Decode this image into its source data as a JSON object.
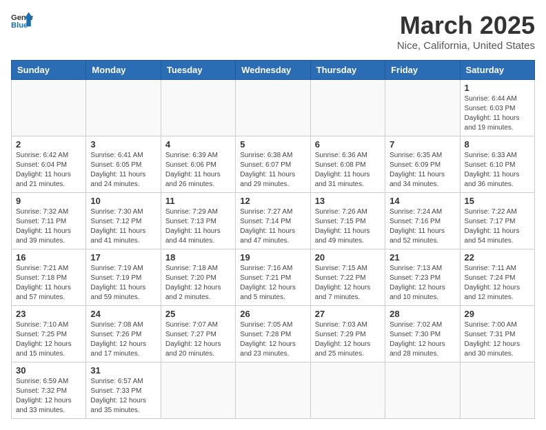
{
  "header": {
    "logo_general": "General",
    "logo_blue": "Blue",
    "title": "March 2025",
    "subtitle": "Nice, California, United States"
  },
  "days_of_week": [
    "Sunday",
    "Monday",
    "Tuesday",
    "Wednesday",
    "Thursday",
    "Friday",
    "Saturday"
  ],
  "weeks": [
    [
      {
        "day": "",
        "info": ""
      },
      {
        "day": "",
        "info": ""
      },
      {
        "day": "",
        "info": ""
      },
      {
        "day": "",
        "info": ""
      },
      {
        "day": "",
        "info": ""
      },
      {
        "day": "",
        "info": ""
      },
      {
        "day": "1",
        "info": "Sunrise: 6:44 AM\nSunset: 6:03 PM\nDaylight: 11 hours\nand 19 minutes."
      }
    ],
    [
      {
        "day": "2",
        "info": "Sunrise: 6:42 AM\nSunset: 6:04 PM\nDaylight: 11 hours\nand 21 minutes."
      },
      {
        "day": "3",
        "info": "Sunrise: 6:41 AM\nSunset: 6:05 PM\nDaylight: 11 hours\nand 24 minutes."
      },
      {
        "day": "4",
        "info": "Sunrise: 6:39 AM\nSunset: 6:06 PM\nDaylight: 11 hours\nand 26 minutes."
      },
      {
        "day": "5",
        "info": "Sunrise: 6:38 AM\nSunset: 6:07 PM\nDaylight: 11 hours\nand 29 minutes."
      },
      {
        "day": "6",
        "info": "Sunrise: 6:36 AM\nSunset: 6:08 PM\nDaylight: 11 hours\nand 31 minutes."
      },
      {
        "day": "7",
        "info": "Sunrise: 6:35 AM\nSunset: 6:09 PM\nDaylight: 11 hours\nand 34 minutes."
      },
      {
        "day": "8",
        "info": "Sunrise: 6:33 AM\nSunset: 6:10 PM\nDaylight: 11 hours\nand 36 minutes."
      }
    ],
    [
      {
        "day": "9",
        "info": "Sunrise: 7:32 AM\nSunset: 7:11 PM\nDaylight: 11 hours\nand 39 minutes."
      },
      {
        "day": "10",
        "info": "Sunrise: 7:30 AM\nSunset: 7:12 PM\nDaylight: 11 hours\nand 41 minutes."
      },
      {
        "day": "11",
        "info": "Sunrise: 7:29 AM\nSunset: 7:13 PM\nDaylight: 11 hours\nand 44 minutes."
      },
      {
        "day": "12",
        "info": "Sunrise: 7:27 AM\nSunset: 7:14 PM\nDaylight: 11 hours\nand 47 minutes."
      },
      {
        "day": "13",
        "info": "Sunrise: 7:26 AM\nSunset: 7:15 PM\nDaylight: 11 hours\nand 49 minutes."
      },
      {
        "day": "14",
        "info": "Sunrise: 7:24 AM\nSunset: 7:16 PM\nDaylight: 11 hours\nand 52 minutes."
      },
      {
        "day": "15",
        "info": "Sunrise: 7:22 AM\nSunset: 7:17 PM\nDaylight: 11 hours\nand 54 minutes."
      }
    ],
    [
      {
        "day": "16",
        "info": "Sunrise: 7:21 AM\nSunset: 7:18 PM\nDaylight: 11 hours\nand 57 minutes."
      },
      {
        "day": "17",
        "info": "Sunrise: 7:19 AM\nSunset: 7:19 PM\nDaylight: 11 hours\nand 59 minutes."
      },
      {
        "day": "18",
        "info": "Sunrise: 7:18 AM\nSunset: 7:20 PM\nDaylight: 12 hours\nand 2 minutes."
      },
      {
        "day": "19",
        "info": "Sunrise: 7:16 AM\nSunset: 7:21 PM\nDaylight: 12 hours\nand 5 minutes."
      },
      {
        "day": "20",
        "info": "Sunrise: 7:15 AM\nSunset: 7:22 PM\nDaylight: 12 hours\nand 7 minutes."
      },
      {
        "day": "21",
        "info": "Sunrise: 7:13 AM\nSunset: 7:23 PM\nDaylight: 12 hours\nand 10 minutes."
      },
      {
        "day": "22",
        "info": "Sunrise: 7:11 AM\nSunset: 7:24 PM\nDaylight: 12 hours\nand 12 minutes."
      }
    ],
    [
      {
        "day": "23",
        "info": "Sunrise: 7:10 AM\nSunset: 7:25 PM\nDaylight: 12 hours\nand 15 minutes."
      },
      {
        "day": "24",
        "info": "Sunrise: 7:08 AM\nSunset: 7:26 PM\nDaylight: 12 hours\nand 17 minutes."
      },
      {
        "day": "25",
        "info": "Sunrise: 7:07 AM\nSunset: 7:27 PM\nDaylight: 12 hours\nand 20 minutes."
      },
      {
        "day": "26",
        "info": "Sunrise: 7:05 AM\nSunset: 7:28 PM\nDaylight: 12 hours\nand 23 minutes."
      },
      {
        "day": "27",
        "info": "Sunrise: 7:03 AM\nSunset: 7:29 PM\nDaylight: 12 hours\nand 25 minutes."
      },
      {
        "day": "28",
        "info": "Sunrise: 7:02 AM\nSunset: 7:30 PM\nDaylight: 12 hours\nand 28 minutes."
      },
      {
        "day": "29",
        "info": "Sunrise: 7:00 AM\nSunset: 7:31 PM\nDaylight: 12 hours\nand 30 minutes."
      }
    ],
    [
      {
        "day": "30",
        "info": "Sunrise: 6:59 AM\nSunset: 7:32 PM\nDaylight: 12 hours\nand 33 minutes."
      },
      {
        "day": "31",
        "info": "Sunrise: 6:57 AM\nSunset: 7:33 PM\nDaylight: 12 hours\nand 35 minutes."
      },
      {
        "day": "",
        "info": ""
      },
      {
        "day": "",
        "info": ""
      },
      {
        "day": "",
        "info": ""
      },
      {
        "day": "",
        "info": ""
      },
      {
        "day": "",
        "info": ""
      }
    ]
  ]
}
